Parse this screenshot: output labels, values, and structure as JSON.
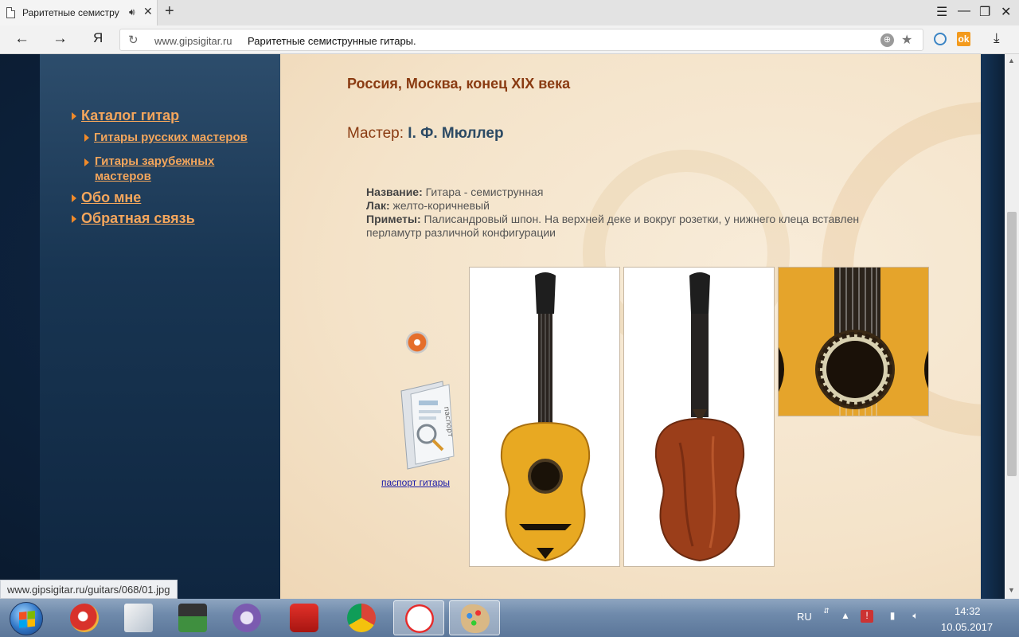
{
  "browser": {
    "tab_title": "Раритетные семистру",
    "new_tab_symbol": "+",
    "address_domain": "www.gipsigitar.ru",
    "address_title": "Раритетные семиструнные гитары.",
    "yandex_letter": "Я"
  },
  "sidebar": {
    "items": [
      {
        "label": "Каталог гитар"
      },
      {
        "label": "Гитары русских мастеров"
      },
      {
        "label": "Гитары зарубежных мастеров"
      },
      {
        "label": "Обо мне"
      },
      {
        "label": "Обратная связь"
      }
    ]
  },
  "content": {
    "heading": "Россия, Москва, конец XIX века",
    "master_label": "Мастер:",
    "master_name": "І. Ф. Мюллер",
    "name_label": "Название:",
    "name_value": "Гитара - семиструнная",
    "lacquer_label": "Лак:",
    "lacquer_value": "желто-коричневый",
    "signs_label": "Приметы:",
    "signs_value": "Палисандровый шпон. На верхней деке и вокруг розетки, у нижнего клеца вставлен перламутр различной конфигурации",
    "passport_link": "паспорт гитары",
    "passport_icon_text": "паспорт"
  },
  "status_url": "www.gipsigitar.ru/guitars/068/01.jpg",
  "taskbar": {
    "language": "RU",
    "time": "14:32",
    "date": "10.05.2017"
  },
  "colors": {
    "menu_link": "#f4a65c",
    "heading": "#8a3b12",
    "master_name": "#2c4a64"
  }
}
